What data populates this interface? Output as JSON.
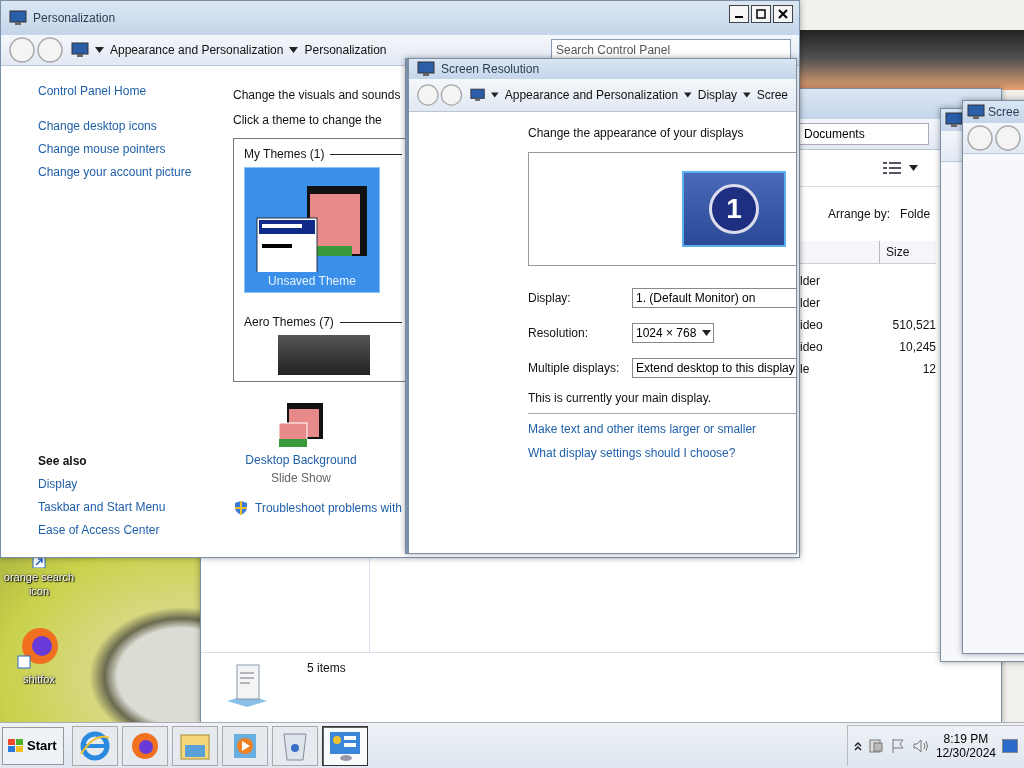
{
  "desktop_icons": [
    {
      "label": "orange search icon",
      "kind": "shortcut"
    },
    {
      "label": "shitfox",
      "kind": "browser"
    }
  ],
  "explorer": {
    "address": "Documents",
    "arrange_label": "Arrange by:",
    "arrange_value": "Folde",
    "size_column": "Size",
    "rows": [
      {
        "type": "lder",
        "size": ""
      },
      {
        "type": "lder",
        "size": ""
      },
      {
        "type": "ideo",
        "size": "510,521"
      },
      {
        "type": "ideo",
        "size": "10,245"
      },
      {
        "type": "le",
        "size": "12"
      }
    ],
    "status": "5 items"
  },
  "side_windows": [
    {
      "kind": "plain"
    },
    {
      "kind": "nav",
      "title": "Scree"
    }
  ],
  "personalization": {
    "title": "Personalization",
    "breadcrumb": [
      "Appearance and Personalization",
      "Personalization"
    ],
    "search_placeholder": "Search Control Panel",
    "sidebar_links": [
      "Control Panel Home",
      "Change desktop icons",
      "Change mouse pointers",
      "Change your account picture"
    ],
    "see_also": {
      "heading": "See also",
      "links": [
        "Display",
        "Taskbar and Start Menu",
        "Ease of Access Center"
      ]
    },
    "intro": [
      "Change the visuals and sounds",
      "Click a theme to change the"
    ],
    "theme_groups": [
      {
        "heading": "My Themes (1)",
        "themes": [
          {
            "label": "Unsaved Theme",
            "selected": true
          }
        ]
      },
      {
        "heading": "Aero Themes (7)",
        "themes": [
          {
            "selected": false
          }
        ]
      }
    ],
    "settings": [
      {
        "label": "Desktop Background",
        "sub": "Slide Show"
      }
    ],
    "troubleshoot": "Troubleshoot problems with"
  },
  "screen_resolution": {
    "title": "Screen Resolution",
    "breadcrumb": [
      "Appearance and Personalization",
      "Display",
      "Scree"
    ],
    "heading": "Change the appearance of your displays",
    "monitor_number": "1",
    "fields": [
      {
        "label": "Display:",
        "value": "1. (Default Monitor) on",
        "kind": "text"
      },
      {
        "label": "Resolution:",
        "value": "1024 × 768",
        "kind": "dropdown"
      },
      {
        "label": "Multiple displays:",
        "value": "Extend desktop to this display",
        "kind": "text"
      }
    ],
    "note": "This is currently your main display.",
    "links": [
      "Make text and other items larger or smaller",
      "What display settings should I choose?"
    ]
  },
  "taskbar": {
    "start": "Start",
    "apps": [
      {
        "kind": "ie",
        "selected": false
      },
      {
        "kind": "firefox",
        "selected": false
      },
      {
        "kind": "explorer",
        "selected": false
      },
      {
        "kind": "media",
        "selected": false
      },
      {
        "kind": "recycle",
        "selected": false
      },
      {
        "kind": "control",
        "selected": true
      }
    ],
    "time": "8:19 PM",
    "date": "12/30/2024"
  }
}
